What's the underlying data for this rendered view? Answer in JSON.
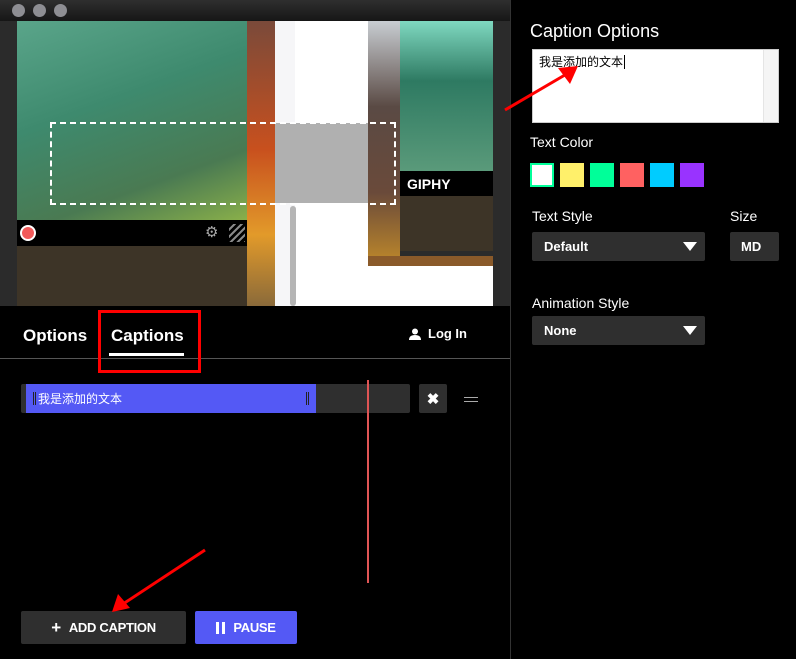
{
  "preview": {
    "giphy_label": "GIPHY"
  },
  "tabs": [
    {
      "label": "Options",
      "active": false
    },
    {
      "label": "Captions",
      "active": true
    }
  ],
  "login_label": "Log In",
  "timeline": {
    "caption_text": "我是添加的文本",
    "accent_color": "#5459f5"
  },
  "buttons": {
    "add_caption": "ADD CAPTION",
    "pause": "PAUSE"
  },
  "caption_options": {
    "title": "Caption Options",
    "text_value": "我是添加的文本",
    "text_color_label": "Text Color",
    "colors": [
      "#ffffff",
      "#fff06a",
      "#00ff99",
      "#ff6161",
      "#00ccff",
      "#9933ff"
    ],
    "selected_color": "#ffffff",
    "text_style_label": "Text Style",
    "text_style_value": "Default",
    "size_label": "Size",
    "size_value": "MD",
    "animation_style_label": "Animation Style",
    "animation_style_value": "None"
  }
}
